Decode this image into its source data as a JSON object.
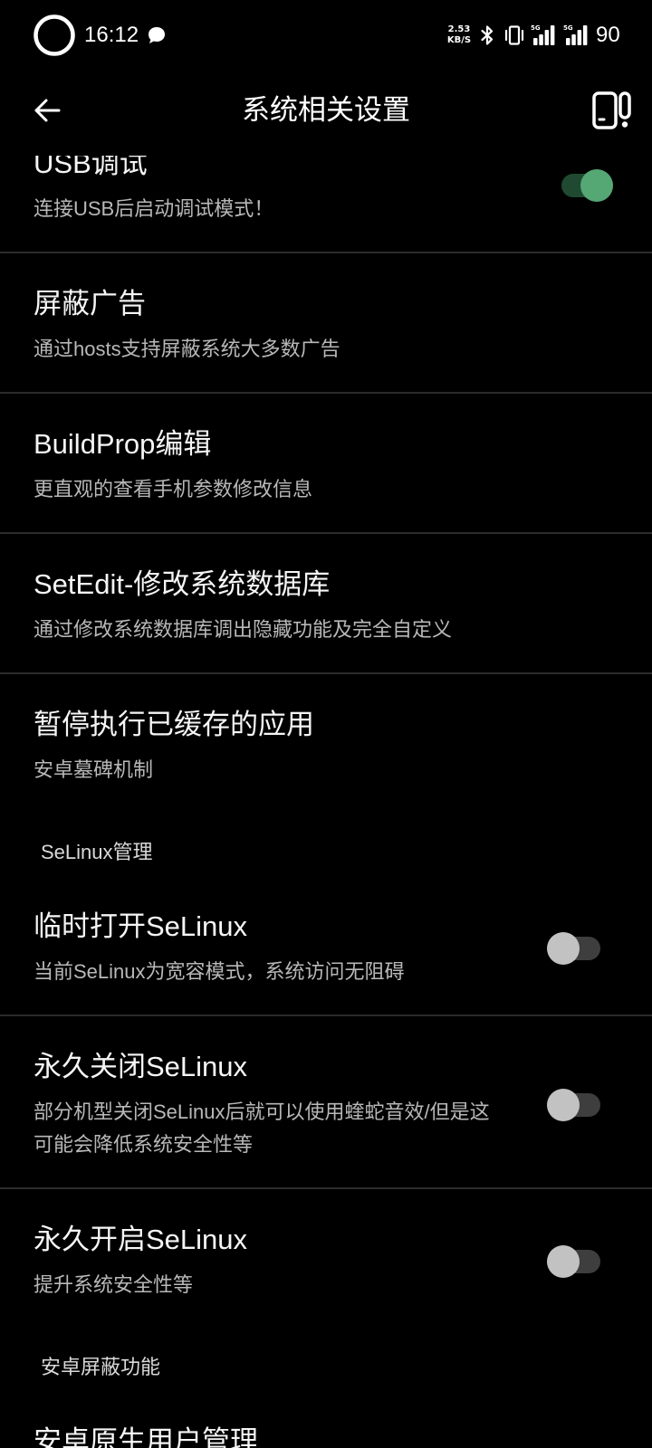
{
  "status_bar": {
    "time": "16:12",
    "net_speed": "2.53",
    "net_speed_unit": "KB/S",
    "sim1_network": "5G",
    "sim2_network": "5G",
    "battery": "90",
    "icons": [
      "ring-status-icon",
      "chat-bubble-icon",
      "bluetooth-icon",
      "vibrate-icon",
      "signal-strength-icon",
      "signal-strength-icon"
    ]
  },
  "header": {
    "title": "系统相关设置",
    "back_icon": "back-arrow-icon",
    "action_icon": "device-info-icon"
  },
  "theme": {
    "background": "#000000",
    "text_primary": "#f5f5f5",
    "text_secondary": "#b8b8b8",
    "section_text": "#d9d9d9",
    "divider": "#2b2b2b",
    "switch_on_thumb": "#55a773",
    "switch_on_track": "#1f4a31",
    "switch_off_thumb": "#c2c2c2",
    "switch_off_track": "#3e3e3e"
  },
  "list": [
    {
      "title": "USB调试",
      "subtitle": "连接USB后启动调试模式！",
      "switch": true
    },
    {
      "title": "屏蔽广告",
      "subtitle": "通过hosts支持屏蔽系统大多数广告"
    },
    {
      "title": "BuildProp编辑",
      "subtitle": "更直观的查看手机参数修改信息"
    },
    {
      "title": "SetEdit-修改系统数据库",
      "subtitle": "通过修改系统数据库调出隐藏功能及完全自定义"
    },
    {
      "title": "暂停执行已缓存的应用",
      "subtitle": "安卓墓碑机制"
    },
    {
      "section": "SeLinux管理"
    },
    {
      "title": "临时打开SeLinux",
      "subtitle": "当前SeLinux为宽容模式，系统访问无阻碍",
      "switch": false
    },
    {
      "title": "永久关闭SeLinux",
      "subtitle_lines": [
        "部分机型关闭SeLinux后就可以使用蝰蛇音效/但是这",
        "可能会降低系统安全性等"
      ],
      "switch": false
    },
    {
      "title": "永久开启SeLinux",
      "subtitle": "提升系统安全性等",
      "switch": false
    },
    {
      "section": "安卓屏蔽功能"
    },
    {
      "title": "安卓原生用户管理"
    }
  ]
}
